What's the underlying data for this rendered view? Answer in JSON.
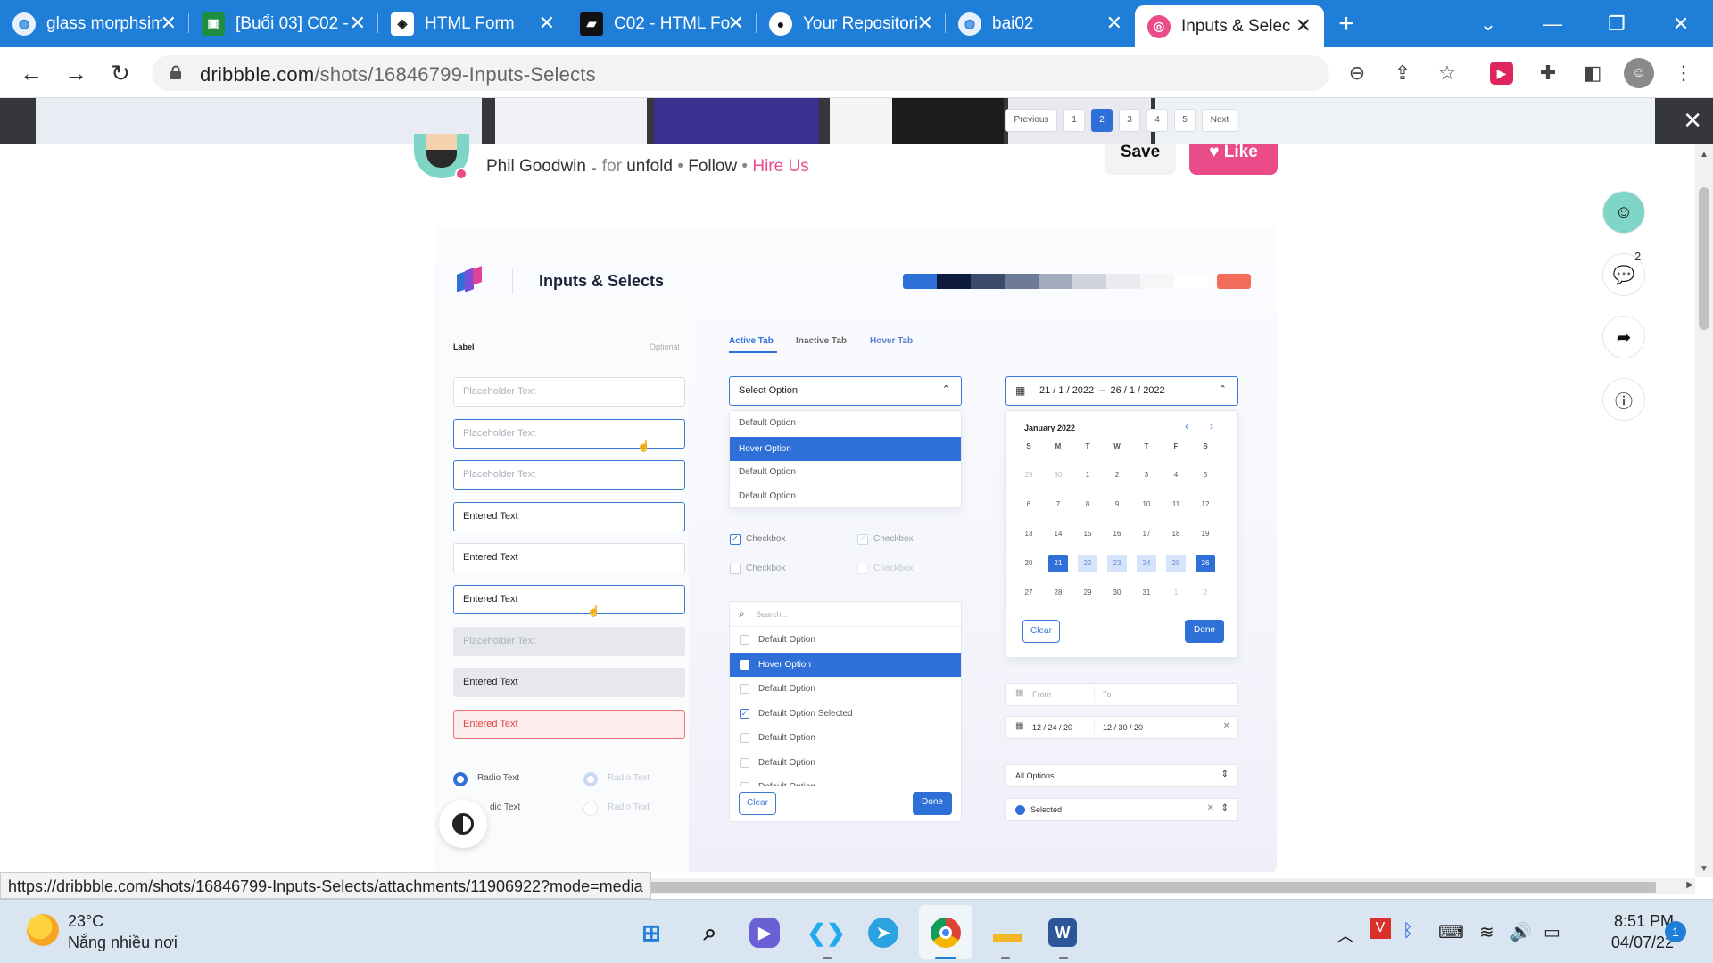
{
  "browser": {
    "tabs": [
      {
        "title": "glass morphsim",
        "icon": "globe-icon"
      },
      {
        "title": "[Buổi 03] C02 -",
        "icon": "classroom-icon"
      },
      {
        "title": "HTML Form",
        "icon": "codepen-icon"
      },
      {
        "title": "C02 - HTML Fo",
        "icon": "slides-icon"
      },
      {
        "title": "Your Repositori",
        "icon": "github-icon"
      },
      {
        "title": "bai02",
        "icon": "globe-icon"
      },
      {
        "title": "Inputs & Selec",
        "icon": "dribbble-icon"
      }
    ],
    "url_host": "dribbble.com",
    "url_path": "/shots/16846799-Inputs-Selects",
    "status_url": "https://dribbble.com/shots/16846799-Inputs-Selects/attachments/11906922?mode=media"
  },
  "shot_header": {
    "author": "Phil Goodwin",
    "for_word": "for",
    "team": "unfold",
    "follow": "Follow",
    "hire": "Hire Us",
    "save": "Save",
    "like": "Like",
    "comments_count": "2"
  },
  "shot": {
    "title": "Inputs & Selects",
    "palette": [
      "#2f6fd8",
      "#0f1b3d",
      "#3b4a6b",
      "#6e7b96",
      "#a3acbd",
      "#cfd4dd",
      "#e9ebef",
      "#f5f6f8",
      "#ffffff",
      "#f36b5b"
    ],
    "label": "Label",
    "optional": "Optional",
    "fields": [
      {
        "text": "Placeholder Text",
        "style": "ph"
      },
      {
        "text": "Placeholder Text",
        "style": "ph blue"
      },
      {
        "text": "Placeholder Text",
        "style": "ph blue"
      },
      {
        "text": "Entered Text",
        "style": "blue"
      },
      {
        "text": "Entered Text",
        "style": ""
      },
      {
        "text": "Entered Text",
        "style": "blue"
      },
      {
        "text": "Placeholder Text",
        "style": "ph grey"
      },
      {
        "text": "Entered Text",
        "style": "grey"
      },
      {
        "text": "Entered Text",
        "style": "err"
      }
    ],
    "radios": [
      "Radio Text",
      "Radio Text",
      "dio Text",
      "Radio Text"
    ],
    "tabs": [
      "Active Tab",
      "Inactive Tab",
      "Hover Tab"
    ],
    "select": {
      "value": "Select Option",
      "options": [
        "Default Option",
        "Hover Option",
        "Default Option",
        "Default Option"
      ]
    },
    "checkboxes": [
      "Checkbox",
      "Checkbox",
      "Checkbox",
      "Checkbox"
    ],
    "multiselect": {
      "search_placeholder": "Search...",
      "options": [
        "Default Option",
        "Hover Option",
        "Default Option",
        "Default Option Selected",
        "Default Option",
        "Default Option",
        "Default Option"
      ],
      "clear": "Clear",
      "done": "Done"
    },
    "pagination": [
      "Previous",
      "1",
      "2",
      "3",
      "4",
      "5",
      "Next"
    ],
    "datepicker": {
      "range": "21 / 1 / 2022  –  26 / 1 / 2022",
      "month": "January 2022",
      "weekdays": [
        "S",
        "M",
        "T",
        "W",
        "T",
        "F",
        "S"
      ],
      "days": [
        "29",
        "30",
        "1",
        "2",
        "3",
        "4",
        "5",
        "6",
        "7",
        "8",
        "9",
        "10",
        "11",
        "12",
        "13",
        "14",
        "15",
        "16",
        "17",
        "18",
        "19",
        "20",
        "21",
        "22",
        "23",
        "24",
        "25",
        "26",
        "27",
        "28",
        "29",
        "30",
        "31",
        "1",
        "2"
      ],
      "clear": "Clear",
      "done": "Done"
    },
    "from_to": {
      "from": "From",
      "to": "To",
      "from_val": "12 / 24 / 20",
      "to_val": "12 / 30 / 20"
    },
    "all_options": "All Options",
    "selected": "Selected"
  },
  "taskbar": {
    "temp": "23°C",
    "weather": "Nắng nhiều nơi",
    "time": "8:51 PM",
    "date": "04/07/22",
    "notif": "1"
  }
}
